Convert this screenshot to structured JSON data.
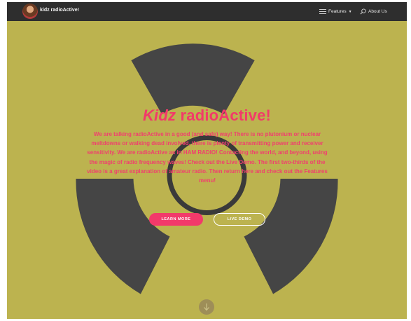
{
  "navbar": {
    "brand": "kidz radioActive!",
    "features_label": "Features",
    "about_label": "About Us"
  },
  "hero": {
    "title_italic": "Kidz",
    "title_rest": " radioActive!",
    "description": "We are talking radioActive in a good (and safe) way! There is no plutonium or nuclear meltdowns or walking dead involved, there is plenty of transmitting power and receiver sensitivity. We are radioActive as in HAM RADIO! Contacting the world, and beyond, using the magic of radio frequency waves! Check out the Live Demo. The first two-thirds of the video is a great explanation of amateur radio. Then return here and check out the Features menu!",
    "learn_more_label": "LEARN MORE",
    "live_demo_label": "LIVE DEMO"
  },
  "colors": {
    "background": "#bcb34f",
    "navbar": "#2e2e2e",
    "accent": "#f23a6a",
    "hazard_symbol": "#454545"
  },
  "icons": {
    "menu": "menu-icon",
    "search": "search-icon",
    "scroll": "arrow-down-icon",
    "avatar": "avatar"
  }
}
